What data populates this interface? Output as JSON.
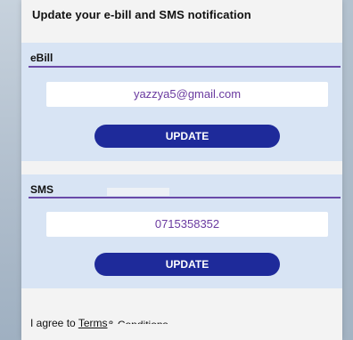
{
  "card": {
    "title": "Update your e-bill and SMS notification"
  },
  "ebill": {
    "label": "eBill",
    "email_value": "yazzya5@gmail.com",
    "update_label": "UPDATE"
  },
  "sms": {
    "label": "SMS",
    "phone_value": "0715358352",
    "update_label": "UPDATE"
  },
  "terms": {
    "prefix": "I agree to ",
    "link": "Terms",
    "suffix": " & Conditions"
  },
  "colors": {
    "section_bg": "#d8e4f4",
    "rule": "#6a4aa8",
    "button": "#1e2a9a",
    "field_text": "#6a3aa0"
  }
}
